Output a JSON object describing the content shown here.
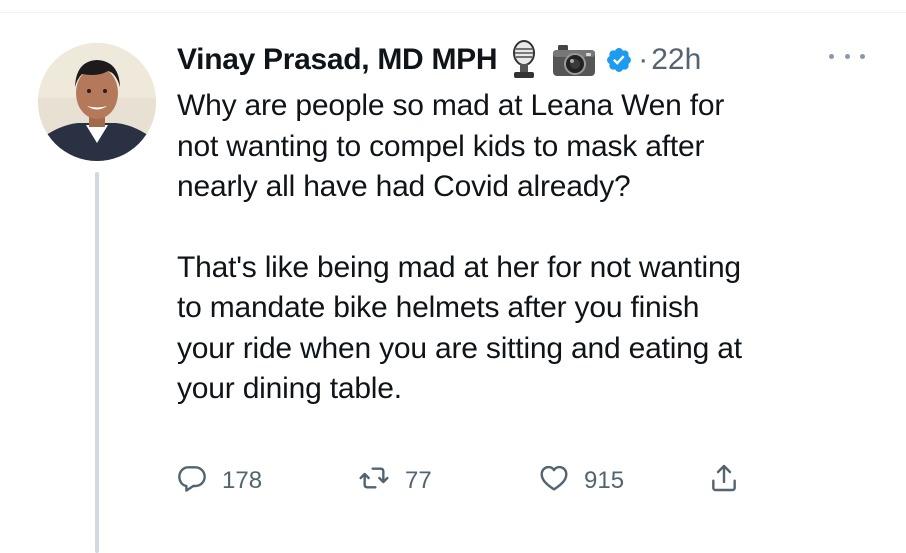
{
  "tweet": {
    "author_name": "Vinay Prasad, MD MPH",
    "separator": "·",
    "timestamp": "22h",
    "body_paragraphs": [
      [
        "Why are people so mad at Leana Wen for",
        "not wanting to compel kids to mask after",
        "nearly all have had Covid already?"
      ],
      [
        "That's like being mad at her for not wanting",
        "to mandate bike helmets after you finish",
        "your ride when you are sitting and eating at",
        "your dining table."
      ]
    ],
    "metrics": {
      "replies": "178",
      "retweets": "77",
      "likes": "915"
    }
  },
  "icons": {
    "author_emojis": [
      "microphone-icon",
      "camera-icon"
    ],
    "badge": "verified-badge-icon",
    "actions": [
      "reply-icon",
      "retweet-icon",
      "like-icon",
      "share-icon"
    ],
    "menu": "more-options-icon"
  },
  "colors": {
    "text": "#0f1419",
    "muted": "#536471",
    "verified": "#1d9bf0",
    "thread_line": "#cfd9de"
  }
}
